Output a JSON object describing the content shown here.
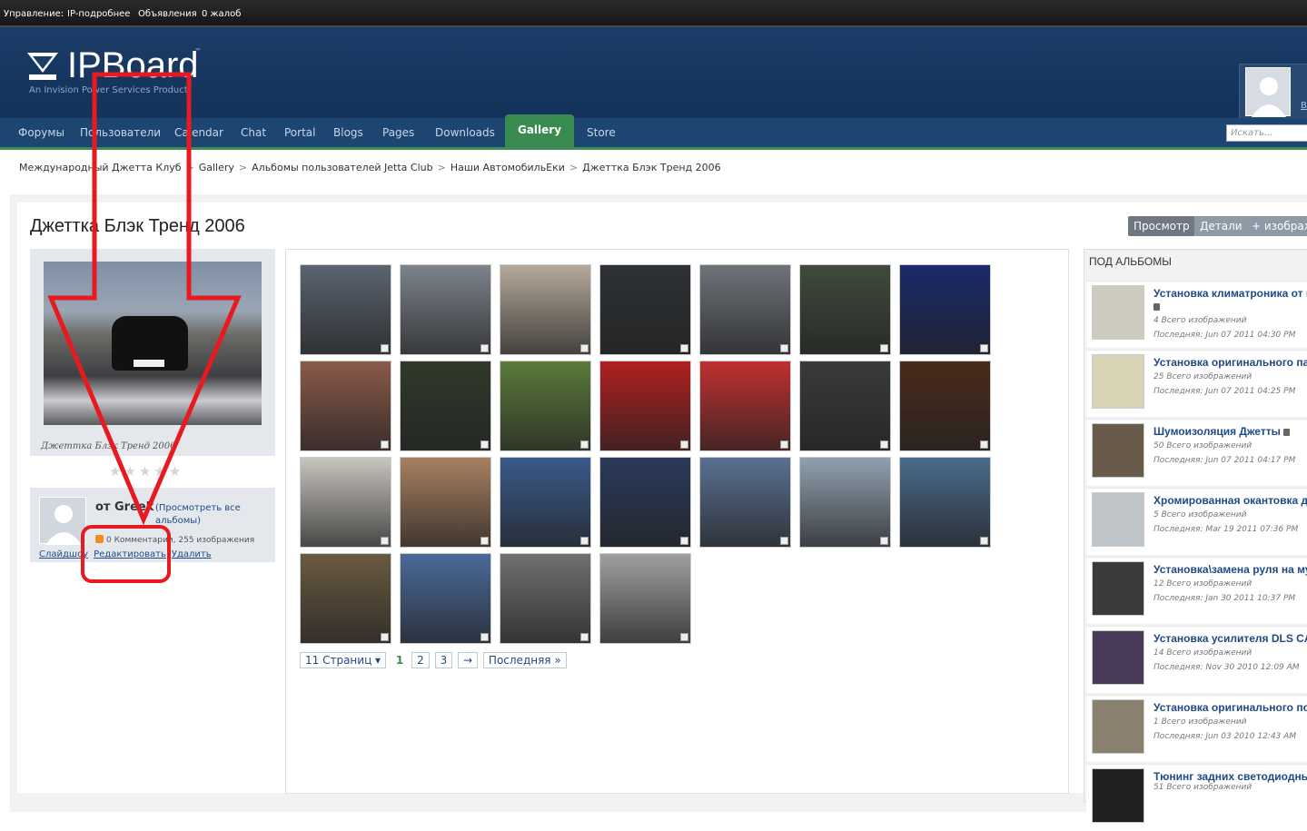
{
  "admin_bar": {
    "items": [
      "Управление:",
      "IP-подробнее",
      "Объявления",
      "0 жалоб"
    ]
  },
  "logo": {
    "name": "IPBoard",
    "tm": "™",
    "tagline": "An Invision Power Services Product"
  },
  "user": {
    "link": "В"
  },
  "nav": {
    "tabs": [
      "Форумы",
      "Пользователи",
      "Calendar",
      "Chat",
      "Portal",
      "Blogs",
      "Pages",
      "Downloads",
      "Gallery",
      "Store"
    ],
    "active": "Gallery",
    "search_placeholder": "Искать..."
  },
  "breadcrumb": [
    "Международный Джетта Клуб",
    "Gallery",
    "Альбомы пользователей Jetta Club",
    "Наши АвтомобильЕки",
    "Джеттка Блэк Тренд 2006"
  ],
  "breadcrumb_sep": ">",
  "album": {
    "title": "Джеттка Блэк Тренд 2006",
    "buttons": [
      "Просмотр",
      "Детали",
      "+ изображ"
    ],
    "cover_caption": "Джеттка Блэк Тренд 2006",
    "stars": "★★★★★"
  },
  "owner": {
    "from": "от Greek",
    "view_all": "(Просмотреть все альбомы)",
    "stats": "0 Комментарии, 255 изображения",
    "links": [
      "Слайдшоу",
      "Редактировать",
      "Удалить"
    ]
  },
  "pager": {
    "pages_label": "11 Страниц ▾",
    "current": "1",
    "pages": [
      "2",
      "3"
    ],
    "next": "→",
    "last": "Последняя »"
  },
  "sidebar": {
    "title": "ПОД АЛЬБОМЫ",
    "items": [
      {
        "title": "Установка климатроника от м",
        "locked": true,
        "count": "4 Всего изображений",
        "last": "Последняя: Jun 07 2011 04:30 PM",
        "color": "#cfcac0"
      },
      {
        "title": "Установка оригинального пар",
        "locked": false,
        "count": "25 Всего изображений",
        "last": "Последняя: Jun 07 2011 04:25 PM",
        "color": "#d9d3b5"
      },
      {
        "title": "Шумоизоляция Джетты",
        "locked": true,
        "count": "50 Всего изображений",
        "last": "Последняя: Jun 07 2011 04:17 PM",
        "color": "#6a5a4a"
      },
      {
        "title": "Хромированная окантовка д",
        "locked": false,
        "count": "5 Всего изображений",
        "last": "Последняя: Mar 19 2011 07:36 PM",
        "color": "#bfc4c8"
      },
      {
        "title": "Установка\\замена руля на му",
        "locked": false,
        "count": "12 Всего изображений",
        "last": "Последняя: Jan 30 2011 10:37 PM",
        "color": "#3a3a3a"
      },
      {
        "title": "Установка усилителя DLS CA",
        "locked": false,
        "count": "14 Всего изображений",
        "last": "Последняя: Nov 30 2010 12:09 AM",
        "color": "#4a3a5a"
      },
      {
        "title": "Установка оригинального под",
        "locked": false,
        "count": "1 Всего изображений",
        "last": "Последняя: Jun 03 2010 12:43 AM",
        "color": "#8a8070"
      },
      {
        "title": "Тюнинг задних светодиодны",
        "locked": false,
        "count": "51 Всего изображений",
        "last": "",
        "color": "#202020"
      }
    ]
  },
  "colors": {
    "header": "#1c3d68",
    "nav": "#1d4572",
    "active_tab": "#3a8b52",
    "annotation": "#e8191f"
  }
}
